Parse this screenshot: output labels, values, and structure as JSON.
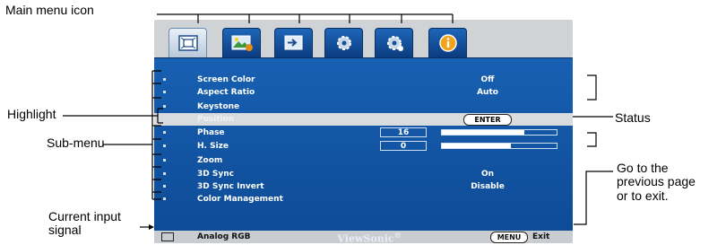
{
  "callouts": {
    "main_menu_icon": "Main menu icon",
    "highlight": "Highlight",
    "sub_menu": "Sub-menu",
    "current_input_line1": "Current input",
    "current_input_line2": "signal",
    "status": "Status",
    "go_back_line1": "Go to the",
    "go_back_line2": "previous page",
    "go_back_line3": "or to exit."
  },
  "tabs": [
    {
      "icon": "display-icon",
      "active": true
    },
    {
      "icon": "picture-icon",
      "active": false
    },
    {
      "icon": "source-icon",
      "active": false
    },
    {
      "icon": "system-setup-basic-icon",
      "active": false
    },
    {
      "icon": "system-setup-advanced-icon",
      "active": false
    },
    {
      "icon": "information-icon",
      "active": false
    }
  ],
  "menu": {
    "items": [
      {
        "label": "Screen Color",
        "value": "Off"
      },
      {
        "label": "Aspect Ratio",
        "value": "Auto"
      },
      {
        "label": "Keystone",
        "value": ""
      },
      {
        "label": "Position",
        "value": "",
        "enter": "ENTER",
        "highlighted": true
      },
      {
        "label": "Phase",
        "number": "16",
        "slider_fraction": 0.72
      },
      {
        "label": "H. Size",
        "number": "0",
        "slider_fraction": 0.6
      },
      {
        "label": "Zoom",
        "value": ""
      },
      {
        "label": "3D Sync",
        "value": "On"
      },
      {
        "label": "3D Sync Invert",
        "value": "Disable"
      },
      {
        "label": "Color Management",
        "value": ""
      }
    ]
  },
  "footer": {
    "input": "Analog RGB",
    "brand": "ViewSonic",
    "brand_mark": "®",
    "menu_key": "MENU",
    "exit": "Exit"
  },
  "colors": {
    "panel": "#1860b2",
    "tab": "#1e66b8",
    "highlight": "#d9dcdf",
    "footer": "#c9cdd1"
  }
}
